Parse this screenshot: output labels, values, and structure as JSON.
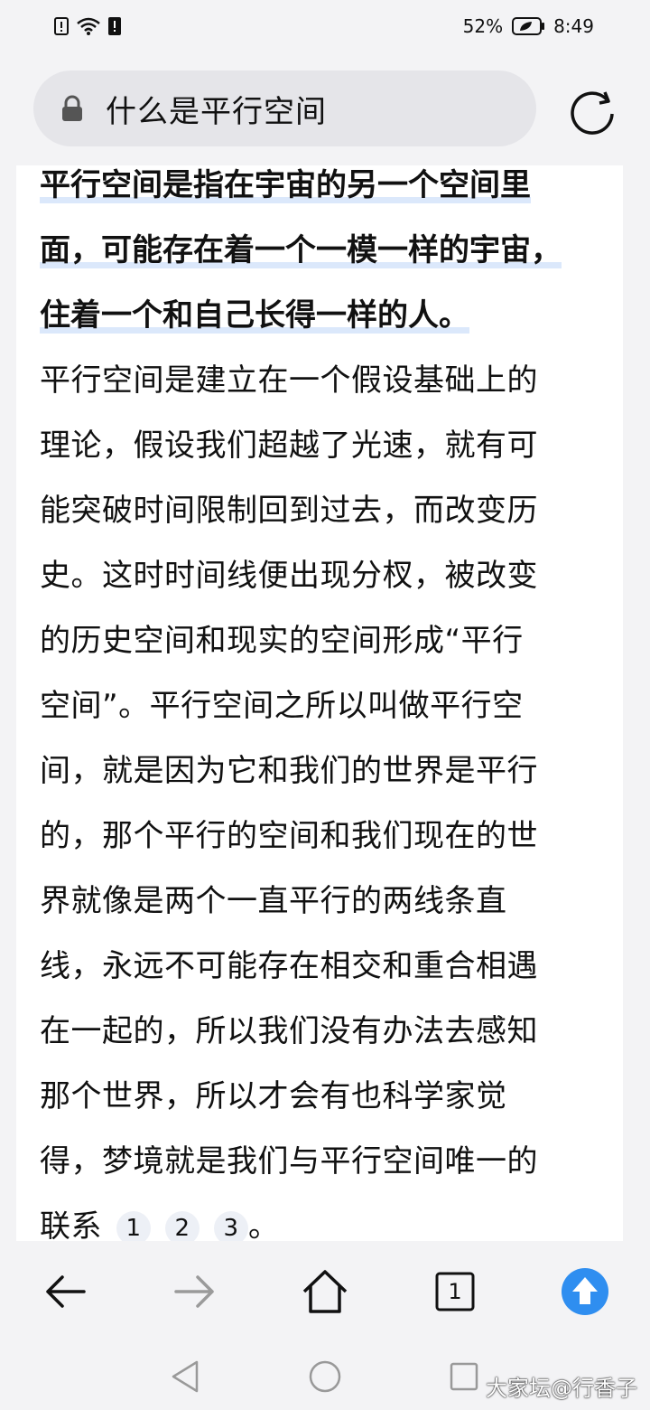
{
  "status_bar": {
    "battery_percent": "52%",
    "time": "8:49"
  },
  "address_bar": {
    "query": "什么是平行空间"
  },
  "article": {
    "highlight_lines": [
      "平行空间是指在宇宙的另一个空间里",
      "面，可能存在着一个一模一样的宇宙，",
      "住着一个和自己长得一样的人。"
    ],
    "body_lines": [
      "平行空间是建立在一个假设基础上的",
      "理论，假设我们超越了光速，就有可",
      "能突破时间限制回到过去，而改变历",
      "史。这时时间线便出现分杈，被改变",
      "的历史空间和现实的空间形成“平行",
      "空间”。平行空间之所以叫做平行空",
      "间，就是因为它和我们的世界是平行",
      "的，那个平行的空间和我们现在的世",
      "界就像是两个一直平行的两线条直",
      "线，永远不可能存在相交和重合相遇",
      "在一起的，所以我们没有办法去感知",
      "那个世界，所以才会有也科学家觉",
      "得，梦境就是我们与平行空间唯一的"
    ],
    "last_line": "联系",
    "refs": [
      "1",
      "2",
      "3"
    ],
    "end_punct": "。"
  },
  "toolbar": {
    "tab_count": "1"
  },
  "watermark": "大家坛@行香子",
  "colors": {
    "accent_blue": "#2f8ef0",
    "highlight": "#dbe8fb"
  }
}
